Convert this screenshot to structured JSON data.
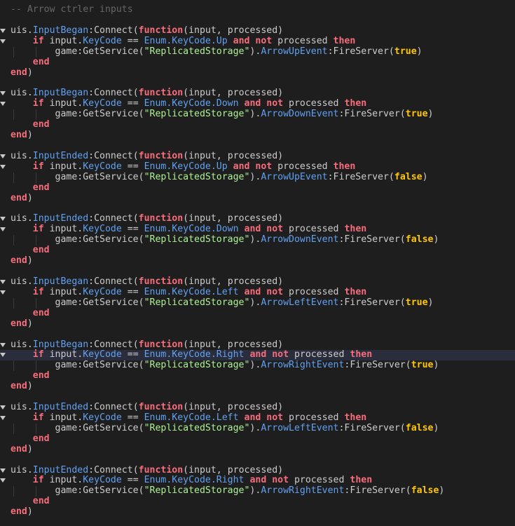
{
  "colors": {
    "background": "#1e1e1e",
    "keyword": "#f86d7c",
    "property": "#61a1f1",
    "string": "#adf195",
    "bool": "#ffc600",
    "comment": "#666666",
    "text": "#cccccc",
    "current_line": "#2a2d3b"
  },
  "editor": {
    "highlighted_line": 33,
    "lines": [
      [
        [
          "c",
          "-- Arrow ctrler inputs"
        ]
      ],
      [],
      [
        [
          "t",
          "uis."
        ],
        [
          "p",
          "InputBegan"
        ],
        [
          "t",
          ":Connect("
        ],
        [
          "k",
          "function"
        ],
        [
          "t",
          "(input, processed)"
        ]
      ],
      [
        [
          "t",
          "    "
        ],
        [
          "k",
          "if"
        ],
        [
          "t",
          " input."
        ],
        [
          "p",
          "KeyCode"
        ],
        [
          "t",
          " == "
        ],
        [
          "p",
          "Enum.KeyCode.Up"
        ],
        [
          "t",
          " "
        ],
        [
          "k",
          "and not"
        ],
        [
          "t",
          " processed "
        ],
        [
          "k",
          "then"
        ]
      ],
      [
        [
          "t",
          "        game:GetService("
        ],
        [
          "s",
          "\"ReplicatedStorage\""
        ],
        [
          "t",
          ")."
        ],
        [
          "p",
          "ArrowUpEvent"
        ],
        [
          "t",
          ":FireServer("
        ],
        [
          "b",
          "true"
        ],
        [
          "t",
          ")"
        ]
      ],
      [
        [
          "t",
          "    "
        ],
        [
          "k",
          "end"
        ]
      ],
      [
        [
          "k",
          "end"
        ],
        [
          "t",
          ")"
        ]
      ],
      [],
      [
        [
          "t",
          "uis."
        ],
        [
          "p",
          "InputBegan"
        ],
        [
          "t",
          ":Connect("
        ],
        [
          "k",
          "function"
        ],
        [
          "t",
          "(input, processed)"
        ]
      ],
      [
        [
          "t",
          "    "
        ],
        [
          "k",
          "if"
        ],
        [
          "t",
          " input."
        ],
        [
          "p",
          "KeyCode"
        ],
        [
          "t",
          " == "
        ],
        [
          "p",
          "Enum.KeyCode.Down"
        ],
        [
          "t",
          " "
        ],
        [
          "k",
          "and not"
        ],
        [
          "t",
          " processed "
        ],
        [
          "k",
          "then"
        ]
      ],
      [
        [
          "t",
          "        game:GetService("
        ],
        [
          "s",
          "\"ReplicatedStorage\""
        ],
        [
          "t",
          ")."
        ],
        [
          "p",
          "ArrowDownEvent"
        ],
        [
          "t",
          ":FireServer("
        ],
        [
          "b",
          "true"
        ],
        [
          "t",
          ")"
        ]
      ],
      [
        [
          "t",
          "    "
        ],
        [
          "k",
          "end"
        ]
      ],
      [
        [
          "k",
          "end"
        ],
        [
          "t",
          ")"
        ]
      ],
      [],
      [
        [
          "t",
          "uis."
        ],
        [
          "p",
          "InputEnded"
        ],
        [
          "t",
          ":Connect("
        ],
        [
          "k",
          "function"
        ],
        [
          "t",
          "(input, processed)"
        ]
      ],
      [
        [
          "t",
          "    "
        ],
        [
          "k",
          "if"
        ],
        [
          "t",
          " input."
        ],
        [
          "p",
          "KeyCode"
        ],
        [
          "t",
          " == "
        ],
        [
          "p",
          "Enum.KeyCode.Up"
        ],
        [
          "t",
          " "
        ],
        [
          "k",
          "and not"
        ],
        [
          "t",
          " processed "
        ],
        [
          "k",
          "then"
        ]
      ],
      [
        [
          "t",
          "        game:GetService("
        ],
        [
          "s",
          "\"ReplicatedStorage\""
        ],
        [
          "t",
          ")."
        ],
        [
          "p",
          "ArrowUpEvent"
        ],
        [
          "t",
          ":FireServer("
        ],
        [
          "b",
          "false"
        ],
        [
          "t",
          ")"
        ]
      ],
      [
        [
          "t",
          "    "
        ],
        [
          "k",
          "end"
        ]
      ],
      [
        [
          "k",
          "end"
        ],
        [
          "t",
          ")"
        ]
      ],
      [],
      [
        [
          "t",
          "uis."
        ],
        [
          "p",
          "InputEnded"
        ],
        [
          "t",
          ":Connect("
        ],
        [
          "k",
          "function"
        ],
        [
          "t",
          "(input, processed)"
        ]
      ],
      [
        [
          "t",
          "    "
        ],
        [
          "k",
          "if"
        ],
        [
          "t",
          " input."
        ],
        [
          "p",
          "KeyCode"
        ],
        [
          "t",
          " == "
        ],
        [
          "p",
          "Enum.KeyCode.Down"
        ],
        [
          "t",
          " "
        ],
        [
          "k",
          "and not"
        ],
        [
          "t",
          " processed "
        ],
        [
          "k",
          "then"
        ]
      ],
      [
        [
          "t",
          "        game:GetService("
        ],
        [
          "s",
          "\"ReplicatedStorage\""
        ],
        [
          "t",
          ")."
        ],
        [
          "p",
          "ArrowDownEvent"
        ],
        [
          "t",
          ":FireServer("
        ],
        [
          "b",
          "false"
        ],
        [
          "t",
          ")"
        ]
      ],
      [
        [
          "t",
          "    "
        ],
        [
          "k",
          "end"
        ]
      ],
      [
        [
          "k",
          "end"
        ],
        [
          "t",
          ")"
        ]
      ],
      [],
      [
        [
          "t",
          "uis."
        ],
        [
          "p",
          "InputBegan"
        ],
        [
          "t",
          ":Connect("
        ],
        [
          "k",
          "function"
        ],
        [
          "t",
          "(input, processed)"
        ]
      ],
      [
        [
          "t",
          "    "
        ],
        [
          "k",
          "if"
        ],
        [
          "t",
          " input."
        ],
        [
          "p",
          "KeyCode"
        ],
        [
          "t",
          " == "
        ],
        [
          "p",
          "Enum.KeyCode.Left"
        ],
        [
          "t",
          " "
        ],
        [
          "k",
          "and not"
        ],
        [
          "t",
          " processed "
        ],
        [
          "k",
          "then"
        ]
      ],
      [
        [
          "t",
          "        game:GetService("
        ],
        [
          "s",
          "\"ReplicatedStorage\""
        ],
        [
          "t",
          ")."
        ],
        [
          "p",
          "ArrowLeftEvent"
        ],
        [
          "t",
          ":FireServer("
        ],
        [
          "b",
          "true"
        ],
        [
          "t",
          ")"
        ]
      ],
      [
        [
          "t",
          "    "
        ],
        [
          "k",
          "end"
        ]
      ],
      [
        [
          "k",
          "end"
        ],
        [
          "t",
          ")"
        ]
      ],
      [],
      [
        [
          "t",
          "uis."
        ],
        [
          "p",
          "InputBegan"
        ],
        [
          "t",
          ":Connect("
        ],
        [
          "k",
          "function"
        ],
        [
          "t",
          "(input, processed)"
        ]
      ],
      [
        [
          "t",
          "    "
        ],
        [
          "k",
          "if"
        ],
        [
          "t",
          " input."
        ],
        [
          "p",
          "KeyCode"
        ],
        [
          "t",
          " == "
        ],
        [
          "p",
          "Enum.KeyCode.Right"
        ],
        [
          "t",
          " "
        ],
        [
          "k",
          "and not"
        ],
        [
          "t",
          " processed "
        ],
        [
          "k",
          "then"
        ]
      ],
      [
        [
          "t",
          "        game:GetService("
        ],
        [
          "s",
          "\"ReplicatedStorage\""
        ],
        [
          "t",
          ")."
        ],
        [
          "p",
          "ArrowRightEvent"
        ],
        [
          "t",
          ":FireServer("
        ],
        [
          "b",
          "true"
        ],
        [
          "t",
          ")"
        ]
      ],
      [
        [
          "t",
          "    "
        ],
        [
          "k",
          "end"
        ]
      ],
      [
        [
          "k",
          "end"
        ],
        [
          "t",
          ")"
        ]
      ],
      [],
      [
        [
          "t",
          "uis."
        ],
        [
          "p",
          "InputEnded"
        ],
        [
          "t",
          ":Connect("
        ],
        [
          "k",
          "function"
        ],
        [
          "t",
          "(input, processed)"
        ]
      ],
      [
        [
          "t",
          "    "
        ],
        [
          "k",
          "if"
        ],
        [
          "t",
          " input."
        ],
        [
          "p",
          "KeyCode"
        ],
        [
          "t",
          " == "
        ],
        [
          "p",
          "Enum.KeyCode.Left"
        ],
        [
          "t",
          " "
        ],
        [
          "k",
          "and not"
        ],
        [
          "t",
          " processed "
        ],
        [
          "k",
          "then"
        ]
      ],
      [
        [
          "t",
          "        game:GetService("
        ],
        [
          "s",
          "\"ReplicatedStorage\""
        ],
        [
          "t",
          ")."
        ],
        [
          "p",
          "ArrowLeftEvent"
        ],
        [
          "t",
          ":FireServer("
        ],
        [
          "b",
          "false"
        ],
        [
          "t",
          ")"
        ]
      ],
      [
        [
          "t",
          "    "
        ],
        [
          "k",
          "end"
        ]
      ],
      [
        [
          "k",
          "end"
        ],
        [
          "t",
          ")"
        ]
      ],
      [],
      [
        [
          "t",
          "uis."
        ],
        [
          "p",
          "InputEnded"
        ],
        [
          "t",
          ":Connect("
        ],
        [
          "k",
          "function"
        ],
        [
          "t",
          "(input, processed)"
        ]
      ],
      [
        [
          "t",
          "    "
        ],
        [
          "k",
          "if"
        ],
        [
          "t",
          " input."
        ],
        [
          "p",
          "KeyCode"
        ],
        [
          "t",
          " == "
        ],
        [
          "p",
          "Enum.KeyCode.Right"
        ],
        [
          "t",
          " "
        ],
        [
          "k",
          "and not"
        ],
        [
          "t",
          " processed "
        ],
        [
          "k",
          "then"
        ]
      ],
      [
        [
          "t",
          "        game:GetService("
        ],
        [
          "s",
          "\"ReplicatedStorage\""
        ],
        [
          "t",
          ")."
        ],
        [
          "p",
          "ArrowRightEvent"
        ],
        [
          "t",
          ":FireServer("
        ],
        [
          "b",
          "false"
        ],
        [
          "t",
          ")"
        ]
      ],
      [
        [
          "t",
          "    "
        ],
        [
          "k",
          "end"
        ]
      ],
      [
        [
          "k",
          "end"
        ],
        [
          "t",
          ")"
        ]
      ]
    ]
  }
}
